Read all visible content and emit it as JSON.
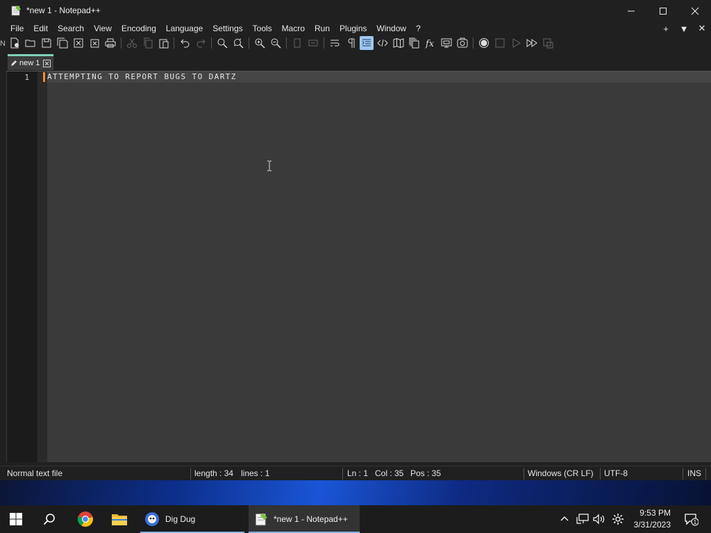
{
  "window": {
    "title": "*new 1 - Notepad++",
    "controls": [
      "minimize",
      "maximize",
      "close"
    ]
  },
  "menubar": {
    "items": [
      "File",
      "Edit",
      "Search",
      "View",
      "Encoding",
      "Language",
      "Settings",
      "Tools",
      "Macro",
      "Run",
      "Plugins",
      "Window",
      "?"
    ],
    "right": [
      "+",
      "▼",
      "✕"
    ]
  },
  "toolbar": {
    "edge_label": "N",
    "buttons": [
      "new-file-icon",
      "open-file-icon",
      "save-icon",
      "save-all-icon",
      "close-icon",
      "close-all-icon",
      "print-icon",
      "cut-icon",
      "copy-icon",
      "paste-icon",
      "undo-icon",
      "redo-icon",
      "find-icon",
      "replace-icon",
      "zoom-in-icon",
      "zoom-out-icon",
      "sync-vertical-icon",
      "sync-horizontal-icon",
      "word-wrap-icon",
      "show-all-chars-icon",
      "indent-guide-icon",
      "xml-tag-icon",
      "document-map-icon",
      "document-list-icon",
      "function-list-icon",
      "folder-workspace-icon",
      "monitoring-icon",
      "record-macro-icon",
      "stop-record-icon",
      "playback-icon",
      "run-multiple-icon",
      "save-macro-icon"
    ]
  },
  "tabs": [
    {
      "label": "new 1",
      "modified": true
    }
  ],
  "editor": {
    "lines": [
      {
        "number": "1",
        "text": "ATTEMPTING TO REPORT BUGS TO DARTZ"
      }
    ]
  },
  "statusbar": {
    "filetype": "Normal text file",
    "length": "length : 34",
    "lines": "lines : 1",
    "ln": "Ln : 1",
    "col": "Col : 35",
    "pos": "Pos : 35",
    "eol": "Windows (CR LF)",
    "encoding": "UTF-8",
    "mode": "INS"
  },
  "taskbar": {
    "apps": [
      {
        "label": "Dig Dug"
      },
      {
        "label": "*new 1 - Notepad++"
      }
    ],
    "clock": {
      "time": "9:53 PM",
      "date": "3/31/2023"
    },
    "notification_count": "1"
  },
  "colors": {
    "accent_tab": "#7fd1b9",
    "caret": "#ff8a32",
    "active_toggle": "#9ec8ee"
  }
}
